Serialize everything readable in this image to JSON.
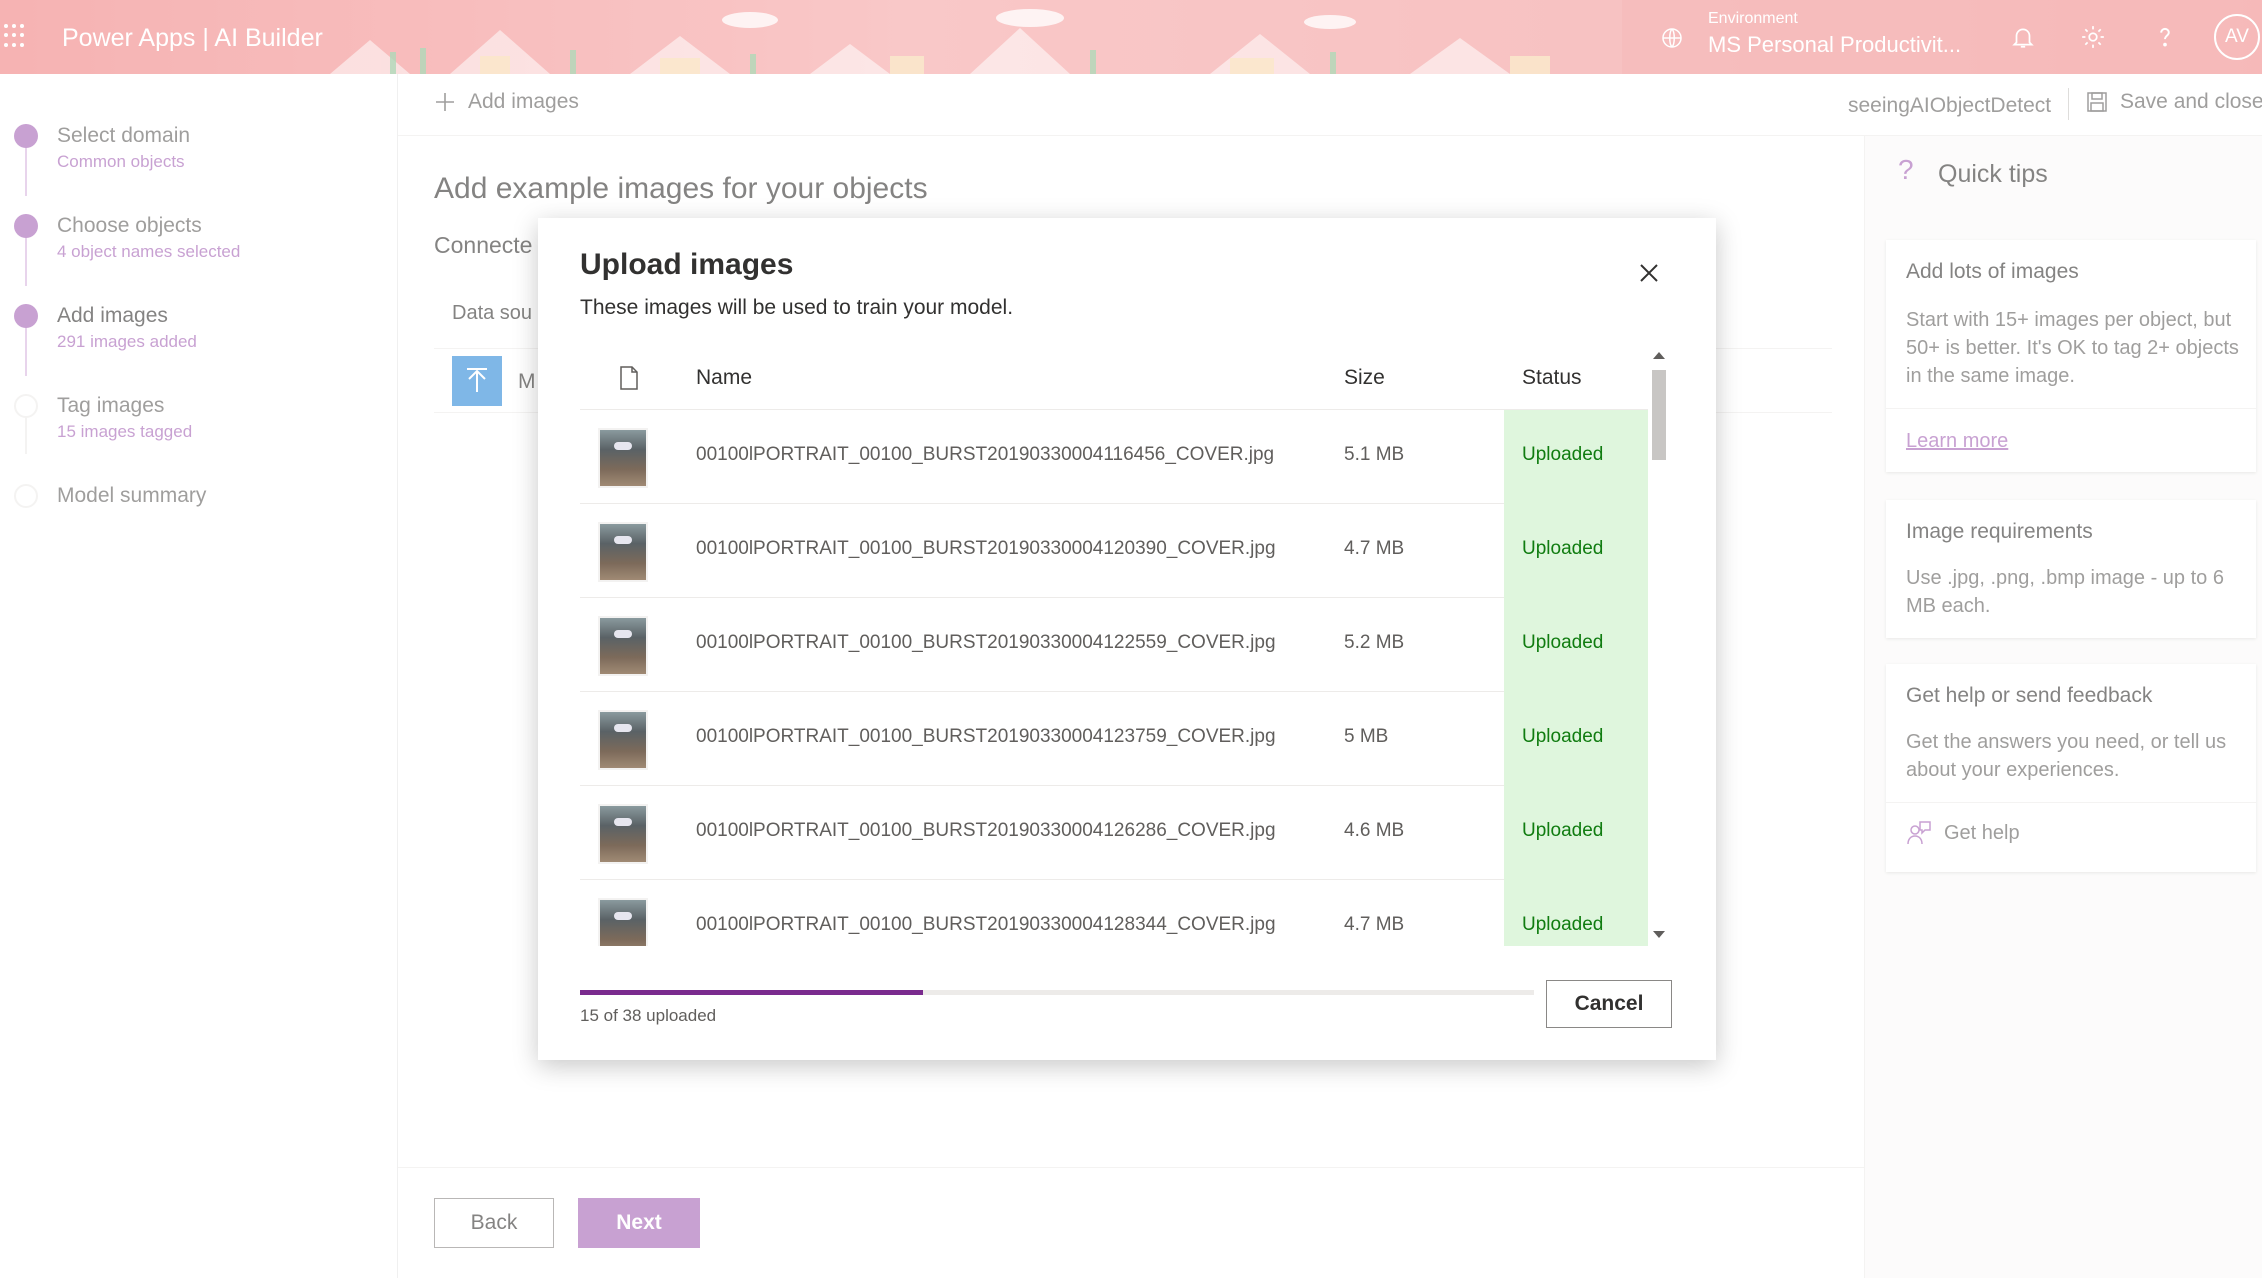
{
  "header": {
    "app_name": "Power Apps  |  AI Builder",
    "environment_label": "Environment",
    "environment_name": "MS Personal Productivit...",
    "user_initials": "AV"
  },
  "steps": [
    {
      "title": "Select domain",
      "subtitle": "Common objects",
      "state": "done"
    },
    {
      "title": "Choose objects",
      "subtitle": "4 object names selected",
      "state": "done"
    },
    {
      "title": "Add images",
      "subtitle": "291 images added",
      "state": "active"
    },
    {
      "title": "Tag images",
      "subtitle": "15 images tagged",
      "state": "todo"
    },
    {
      "title": "Model summary",
      "subtitle": "",
      "state": "todo"
    }
  ],
  "commandbar": {
    "add_images": "Add images",
    "model_name": "seeingAIObjectDetect",
    "save_close": "Save and close"
  },
  "main": {
    "title": "Add example images for your objects",
    "connected_label": "Connecte",
    "data_source_label": "Data sou",
    "data_source_item": "M",
    "back": "Back",
    "next": "Next"
  },
  "tips": {
    "title": "Quick tips",
    "cards": [
      {
        "title": "Add lots of images",
        "body": "Start with 15+ images per object, but 50+ is better. It's OK to tag 2+ objects in the same image.",
        "link": "Learn more"
      },
      {
        "title": "Image requirements",
        "body": "Use .jpg, .png, .bmp image - up to 6 MB each."
      },
      {
        "title": "Get help or send feedback",
        "body": "Get the answers you need, or tell us about your experiences.",
        "link": "Get help"
      }
    ]
  },
  "dialog": {
    "title": "Upload images",
    "subtitle": "These images will be used to train your model.",
    "columns": {
      "name": "Name",
      "size": "Size",
      "status": "Status"
    },
    "rows": [
      {
        "name": "00100lPORTRAIT_00100_BURST20190330004116456_COVER.jpg",
        "size": "5.1 MB",
        "status": "Uploaded"
      },
      {
        "name": "00100lPORTRAIT_00100_BURST20190330004120390_COVER.jpg",
        "size": "4.7 MB",
        "status": "Uploaded"
      },
      {
        "name": "00100lPORTRAIT_00100_BURST20190330004122559_COVER.jpg",
        "size": "5.2 MB",
        "status": "Uploaded"
      },
      {
        "name": "00100lPORTRAIT_00100_BURST20190330004123759_COVER.jpg",
        "size": "5 MB",
        "status": "Uploaded"
      },
      {
        "name": "00100lPORTRAIT_00100_BURST20190330004126286_COVER.jpg",
        "size": "4.6 MB",
        "status": "Uploaded"
      },
      {
        "name": "00100lPORTRAIT_00100_BURST20190330004128344_COVER.jpg",
        "size": "4.7 MB",
        "status": "Uploaded"
      }
    ],
    "progress_fraction": 0.36,
    "progress_text": "15 of 38 uploaded",
    "cancel": "Cancel"
  },
  "colors": {
    "accent": "#a463b5",
    "progress": "#7a2b8e",
    "uploaded_bg": "#dff6dd",
    "uploaded_text": "#107c10"
  }
}
